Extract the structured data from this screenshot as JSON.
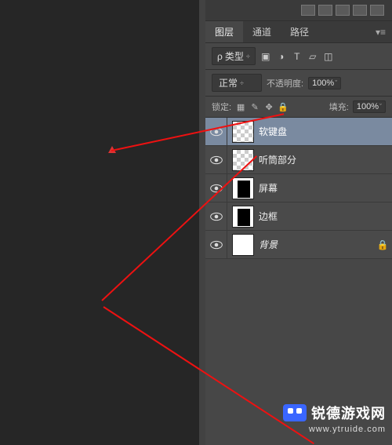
{
  "tabs": {
    "layers": "图层",
    "channels": "通道",
    "paths": "路径"
  },
  "filter": {
    "search": "ρ",
    "kind": "类型",
    "dn": "÷"
  },
  "icons": {
    "img": "▣",
    "fx": "◑",
    "T": "T",
    "shape": "▱",
    "smart": "◫"
  },
  "blend": {
    "mode": "正常",
    "opacity_label": "不透明度:",
    "opacity": "100%",
    "fill_label": "填充:",
    "fill": "100%"
  },
  "lock": {
    "label": "锁定:",
    "i1": "▦",
    "i2": "✎",
    "i3": "✥",
    "i4": "🔒"
  },
  "layers": [
    {
      "name": "软键盘",
      "thumb": "checker",
      "sel": true,
      "locked": false
    },
    {
      "name": "听筒部分",
      "thumb": "checker",
      "sel": false,
      "locked": false
    },
    {
      "name": "屏幕",
      "thumb": "blackrect",
      "sel": false,
      "locked": false
    },
    {
      "name": "边框",
      "thumb": "blackrect",
      "sel": false,
      "locked": false
    },
    {
      "name": "背景",
      "thumb": "white",
      "sel": false,
      "locked": true,
      "italic": true
    }
  ],
  "watermark": {
    "brand": "锐德游戏网",
    "url": "www.ytruide.com"
  }
}
